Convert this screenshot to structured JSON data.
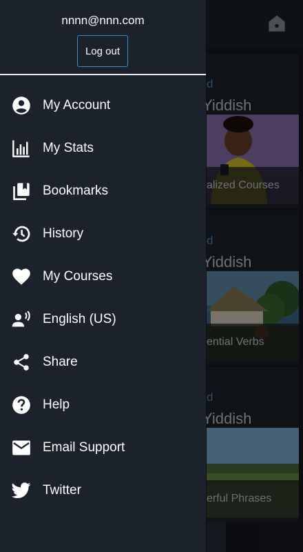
{
  "user": {
    "email": "nnnn@nnn.com"
  },
  "header": {
    "logout_label": "Log out"
  },
  "menu": {
    "items": [
      {
        "label": "My Account",
        "icon": "account-circle-icon"
      },
      {
        "label": "My Stats",
        "icon": "bar-chart-icon"
      },
      {
        "label": "Bookmarks",
        "icon": "bookmarks-icon"
      },
      {
        "label": "History",
        "icon": "history-icon"
      },
      {
        "label": "My Courses",
        "icon": "heart-icon"
      },
      {
        "label": "English (US)",
        "icon": "voice-language-icon"
      },
      {
        "label": "Share",
        "icon": "share-icon"
      },
      {
        "label": "Help",
        "icon": "help-circle-icon"
      },
      {
        "label": "Email Support",
        "icon": "mail-icon"
      },
      {
        "label": "Twitter",
        "icon": "twitter-icon"
      }
    ]
  },
  "background": {
    "home_icon": "home-icon",
    "cards": [
      {
        "small": "d",
        "language": "Yiddish",
        "caption": "alized Courses"
      },
      {
        "small": "d",
        "language": "Yiddish",
        "caption": "ential Verbs"
      },
      {
        "small": "d",
        "language": "Yiddish",
        "caption": "erful Phrases"
      }
    ]
  },
  "colors": {
    "drawer_bg": "#1c222c",
    "accent_border": "#3d8fd1",
    "link_blue": "#4b8ec3"
  }
}
